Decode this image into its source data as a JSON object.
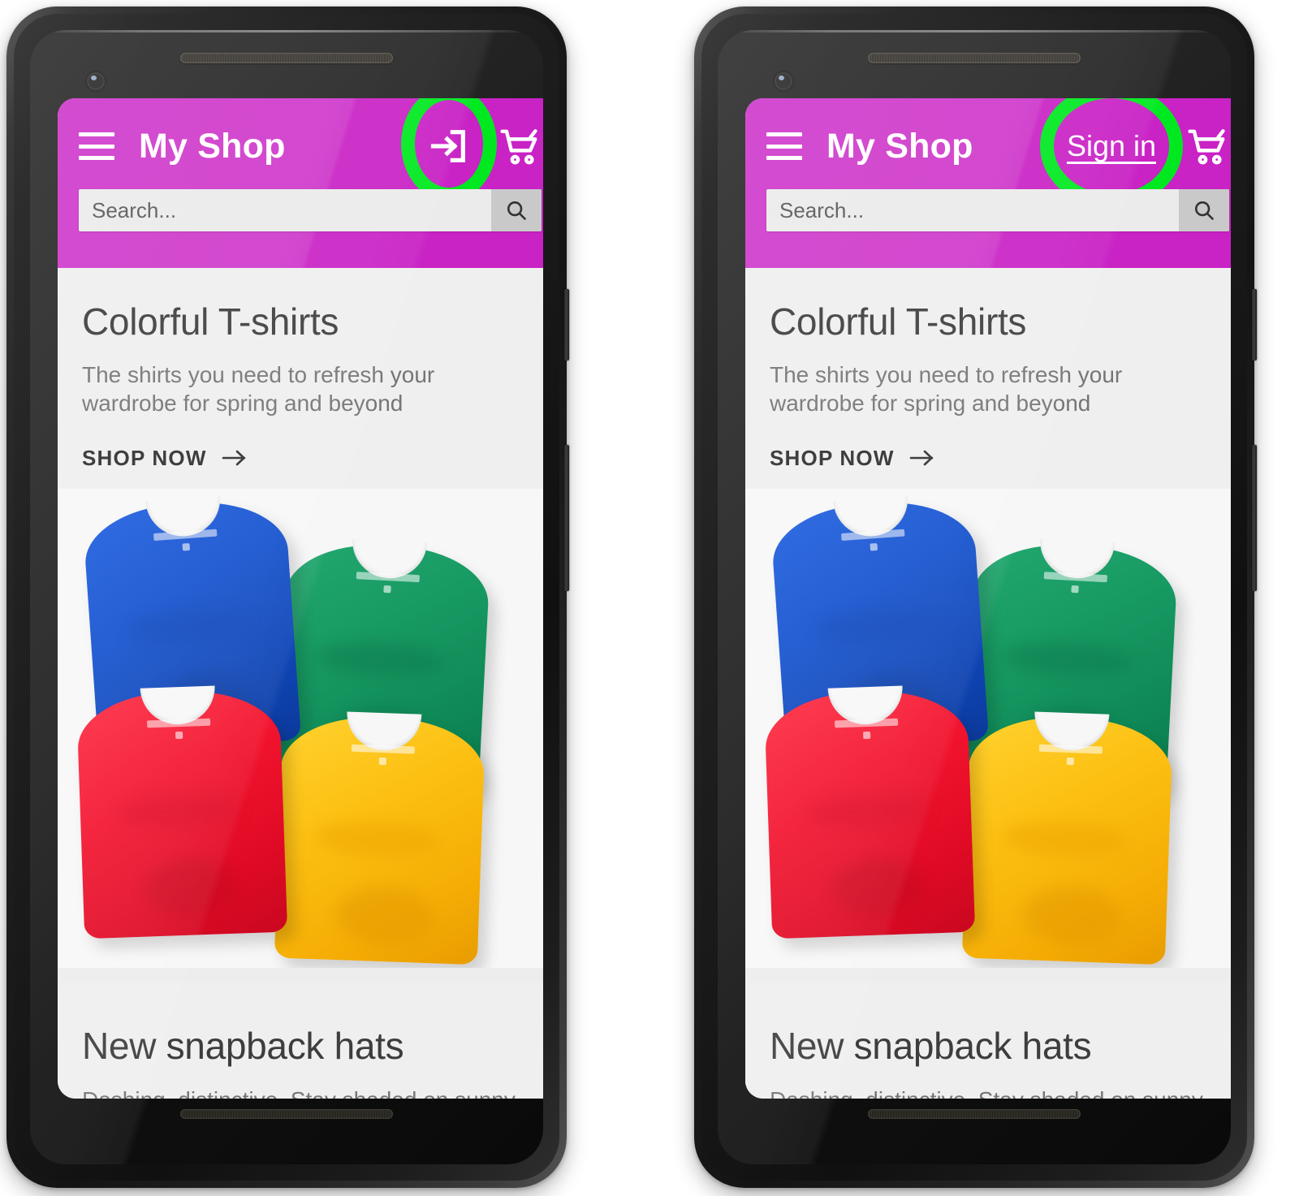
{
  "app": {
    "brand": "My Shop",
    "accent_magenta": "#C922C5",
    "highlight_green": "#00E920",
    "content_bg": "#EDEDED"
  },
  "appbar": {
    "menu_icon": "hamburger-menu-icon",
    "cart_icon": "shopping-cart-icon",
    "search": {
      "placeholder": "Search...",
      "value": "",
      "button_icon": "search-icon"
    }
  },
  "variants": [
    {
      "id": "icon-variant",
      "signin": {
        "mode": "icon",
        "label": "",
        "icon": "login-arrow-icon",
        "highlighted": true
      }
    },
    {
      "id": "text-variant",
      "signin": {
        "mode": "text",
        "label": "Sign in",
        "icon": "",
        "highlighted": true
      }
    }
  ],
  "content": {
    "hero": {
      "title": "Colorful T-shirts",
      "subtitle": "The shirts you need to refresh your wardrobe for spring and beyond",
      "cta_label": "SHOP NOW",
      "cta_icon": "arrow-right-icon",
      "image_alt": "four-tshirts-photo",
      "shirt_colors": [
        "#1452cf",
        "#1d9b67",
        "#f3142f",
        "#fcbf12"
      ]
    },
    "second": {
      "title": "New snapback hats",
      "subtitle": "Dashing, distinctive. Stay shaded on sunny"
    }
  }
}
